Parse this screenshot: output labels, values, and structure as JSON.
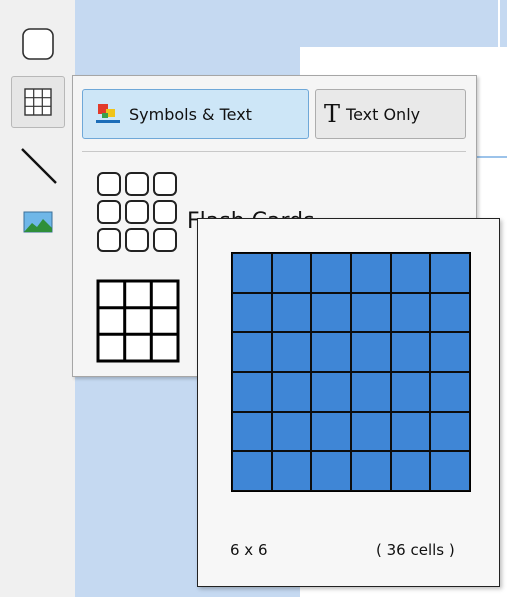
{
  "toolbar": {
    "tools": [
      {
        "name": "shape-tool",
        "icon": "rounded-rect-icon"
      },
      {
        "name": "table-tool",
        "icon": "table-grid-icon",
        "selected": true
      },
      {
        "name": "line-tool",
        "icon": "line-icon"
      },
      {
        "name": "image-tool",
        "icon": "picture-icon"
      }
    ]
  },
  "popup": {
    "symbols_button_label": "Symbols & Text",
    "text_only_button_label": "Text Only",
    "text_only_glyph": "T",
    "options": [
      {
        "label": "Flash Cards",
        "icon": "flash-cards-icon"
      },
      {
        "label": "",
        "icon": "table-3x3-icon"
      }
    ]
  },
  "preview": {
    "rows": 6,
    "cols": 6,
    "dims_label": "6 x 6",
    "cells_label": "( 36 cells )",
    "cell_color": "#3f86d6"
  },
  "colors": {
    "canvas": "#c5d9f1",
    "toolbar": "#f0f0f0",
    "accent_button": "#cde6f7"
  }
}
